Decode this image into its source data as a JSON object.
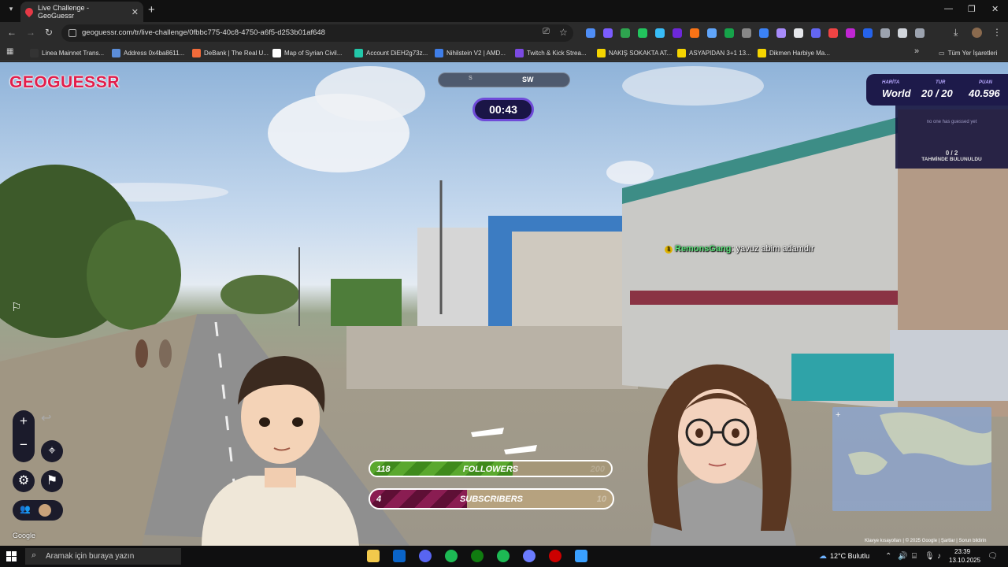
{
  "browser": {
    "tab_title": "Live Challenge - GeoGuessr",
    "url": "geoguessr.com/tr/live-challenge/0fbbc775-40c8-4750-a6f5-d253b01af648",
    "bookmarks": [
      {
        "label": "Linea Mainnet Trans...",
        "color": "#333333"
      },
      {
        "label": "Address 0x4ba8611...",
        "color": "#5b8dd9"
      },
      {
        "label": "DeBank | The Real U...",
        "color": "#f26b3a"
      },
      {
        "label": "Map of Syrian Civil...",
        "color": "#ffffff"
      },
      {
        "label": "Account DiEH2g73z...",
        "color": "#22c7a9"
      },
      {
        "label": "Nihilstein V2 | AMD...",
        "color": "#3f7ee8"
      },
      {
        "label": "Twitch & Kick Strea...",
        "color": "#7b4ae2"
      },
      {
        "label": "NAKIŞ SOKAKTA AT...",
        "color": "#f5d400"
      },
      {
        "label": "ASYAPIDAN 3+1 13...",
        "color": "#f5d400"
      },
      {
        "label": "Dikmen Harbiye Ma...",
        "color": "#f5d400"
      }
    ],
    "all_bookmarks": "Tüm Yer İşaretleri"
  },
  "game": {
    "logo": "GEOGUESSR",
    "compass_heading": "SW",
    "compass_minor": "S",
    "timer": "00:43",
    "map_label": "HARİTA",
    "map_value": "World",
    "round_label": "TUR",
    "round_value": "20 / 20",
    "score_label": "PUAN",
    "score_value": "40.596",
    "guess_status": "no one has guessed yet",
    "guess_count": "0 / 2",
    "guess_found": "TAHMİNDE BULUNULDU",
    "chat_badge": "1",
    "chat_user": "RemonsGang",
    "chat_message": ": yavuz abim adamdır",
    "followers_label": "FOLLOWERS",
    "followers_value": "118",
    "followers_goal": "200",
    "followers_progress": 0.59,
    "subscribers_label": "SUBSCRIBERS",
    "subscribers_value": "4",
    "subscribers_goal": "10",
    "subscribers_progress": 0.4,
    "google_watermark": "Google",
    "maps_attribution": "Klavye kısayolları  |  © 2025 Google  |  Şartlar  |  Sorun bildirin"
  },
  "taskbar": {
    "search_placeholder": "Aramak için buraya yazın",
    "weather": "12°C  Bulutlu",
    "time": "23:39",
    "date": "13.10.2025"
  }
}
